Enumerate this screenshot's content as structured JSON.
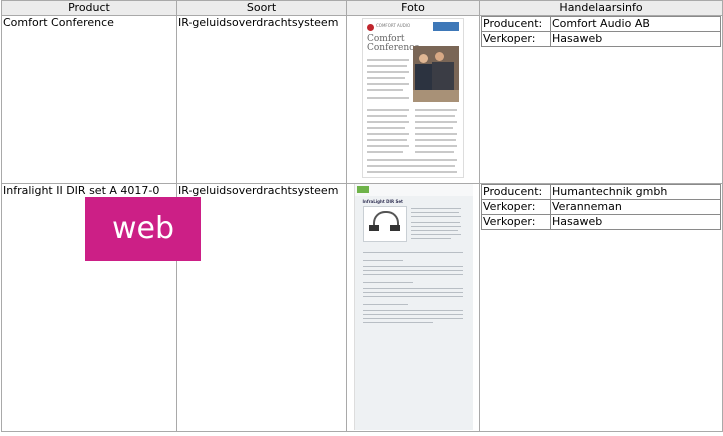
{
  "columns": [
    "Product",
    "Soort",
    "Foto",
    "Handelaarsinfo"
  ],
  "rows": [
    {
      "product": "Comfort Conference",
      "soort": "IR-geluidsoverdrachtsysteem",
      "photo_title": "Comfort Conference",
      "photo_brand": "COMFORT AUDIO",
      "info": [
        {
          "label": "Producent:",
          "value": "Comfort Audio AB"
        },
        {
          "label": "Verkoper:",
          "value": "Hasaweb"
        }
      ]
    },
    {
      "product": "Infralight II DIR set A 4017-0",
      "soort": "IR-geluidsoverdrachtsysteem",
      "photo_title": "InfraLight DIR Set",
      "info": [
        {
          "label": "Producent:",
          "value": "Humantechnik gmbh"
        },
        {
          "label": "Verkoper:",
          "value": "Veranneman"
        },
        {
          "label": "Verkoper:",
          "value": "Hasaweb"
        }
      ]
    }
  ],
  "overlay_badge": "web",
  "colors": {
    "badge": "#cc1f86",
    "header_bg": "#ececec",
    "border": "#a9a9a9"
  }
}
